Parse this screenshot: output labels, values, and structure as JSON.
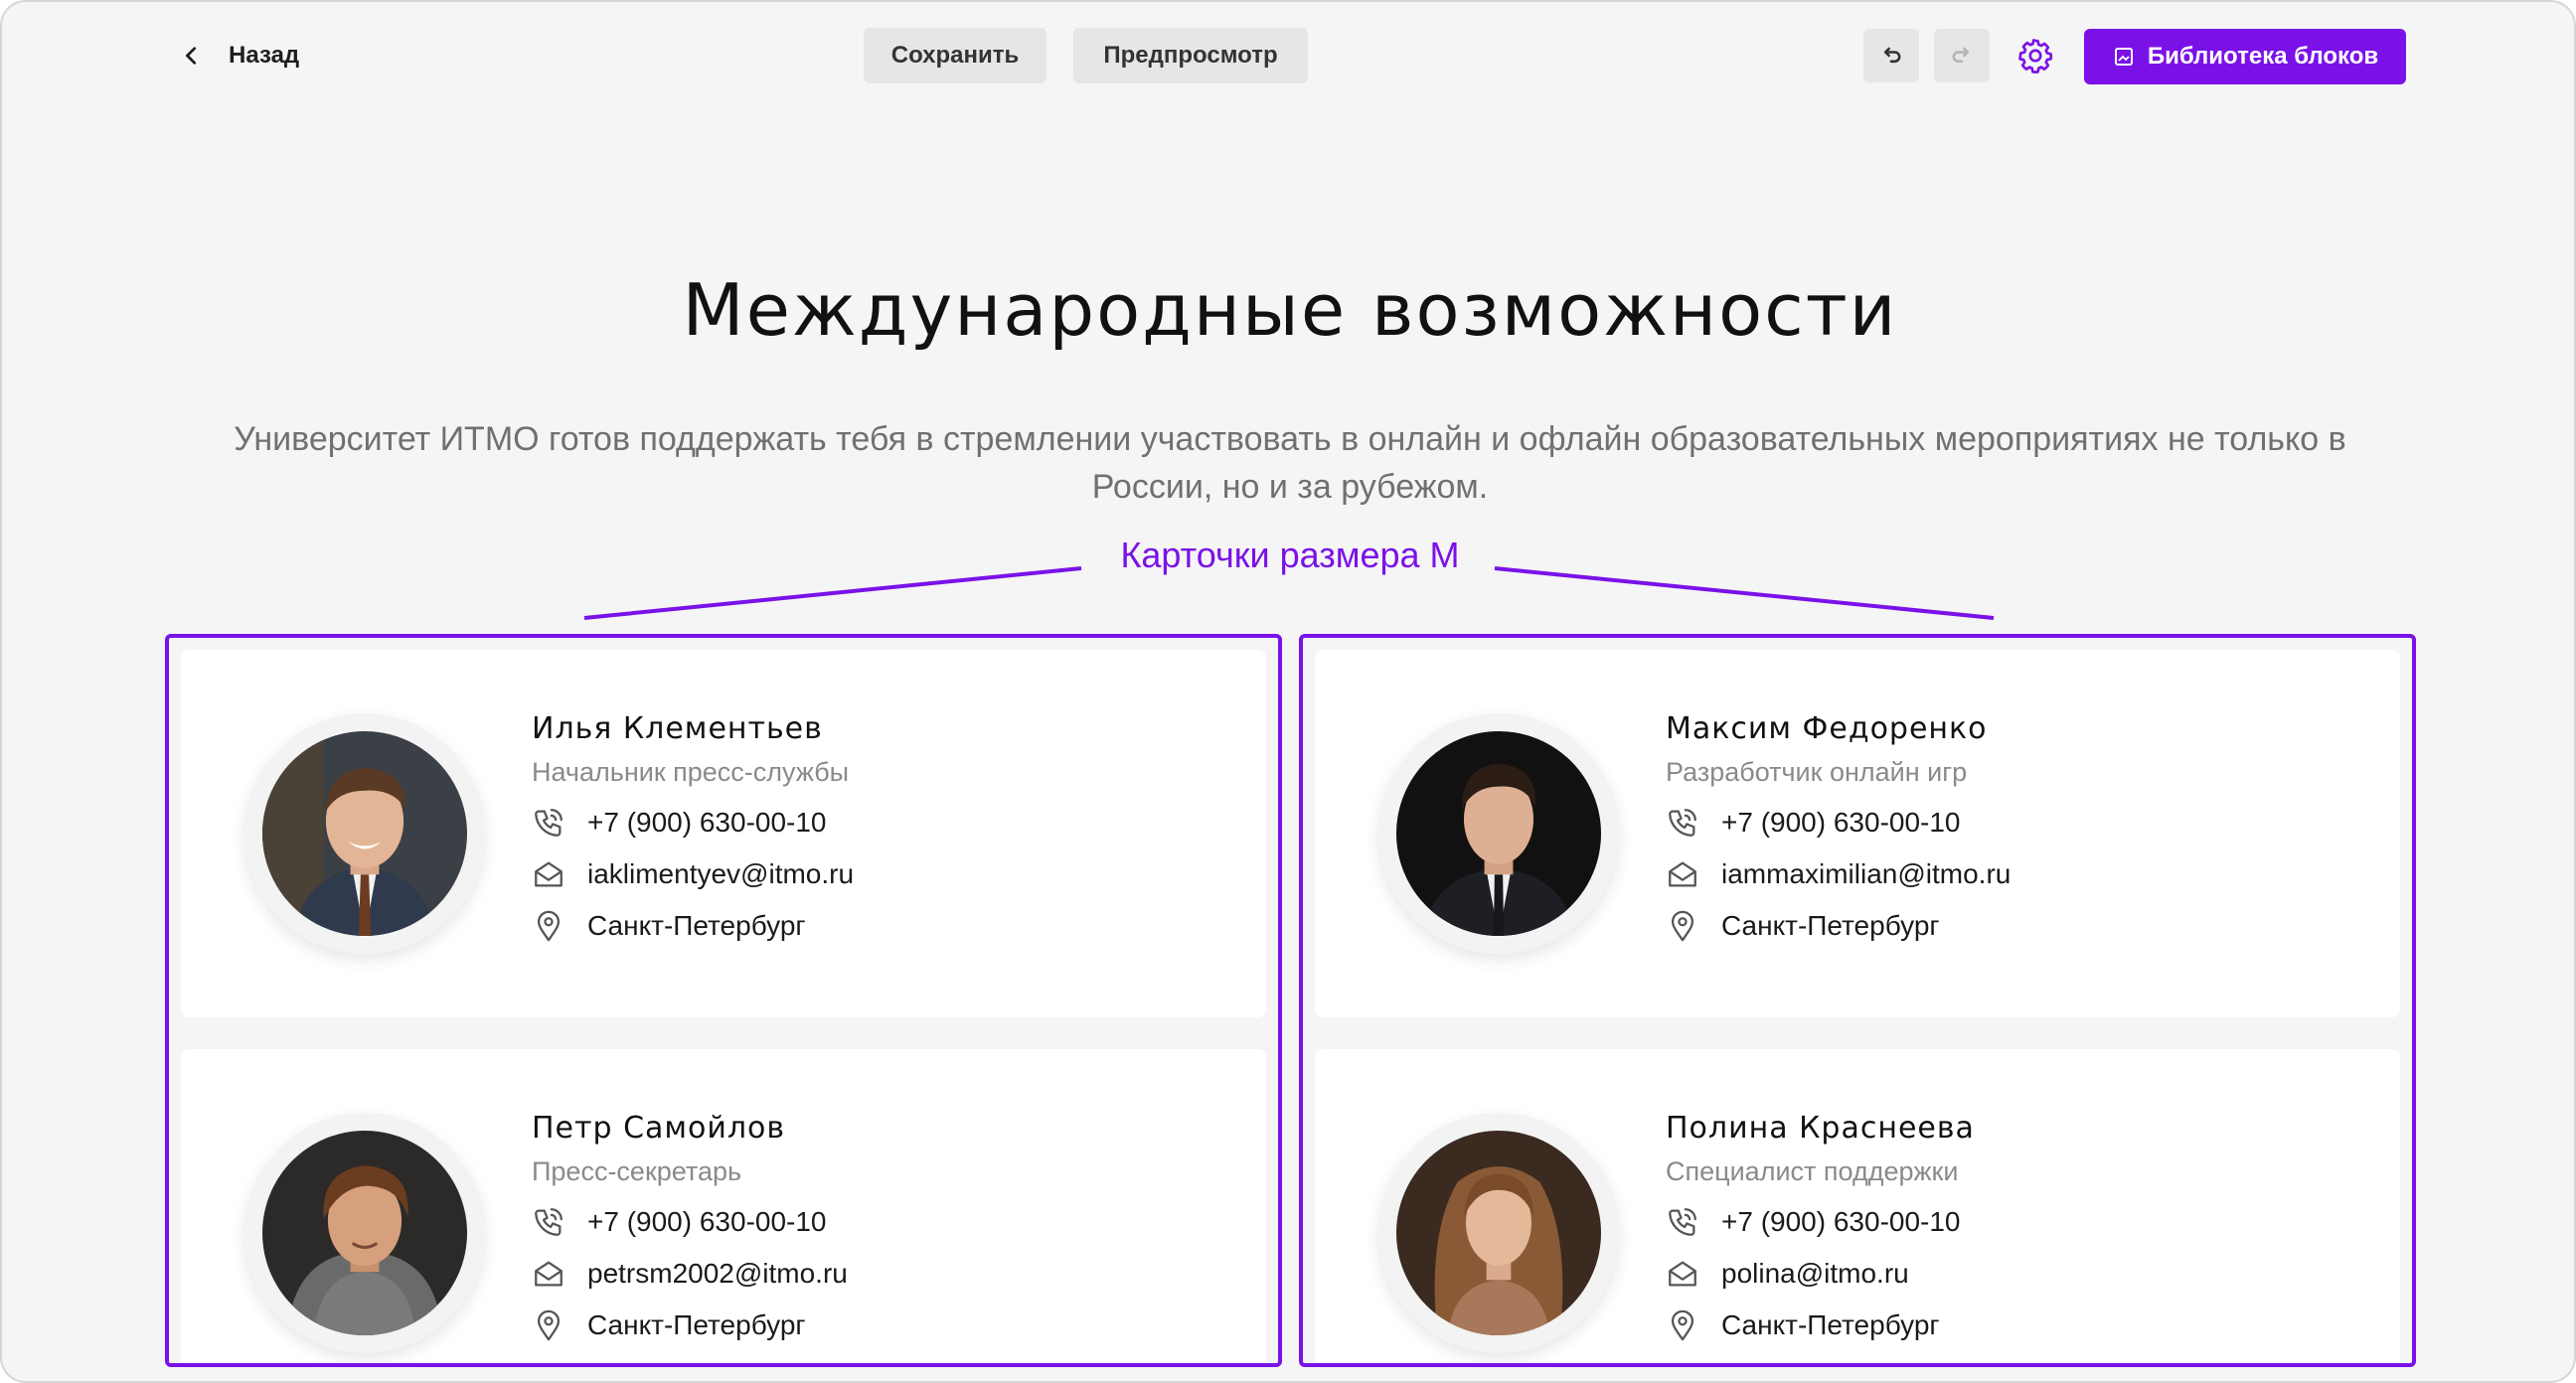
{
  "toolbar": {
    "back_label": "Назад",
    "save_label": "Сохранить",
    "preview_label": "Предпросмотр",
    "library_label": "Библиотека блоков"
  },
  "page": {
    "title": "Международные возможности",
    "subtitle": "Университет ИТМО готов поддержать тебя в стремлении участвовать в онлайн и офлайн образовательных мероприятиях не только в России, но и за рубежом.",
    "annotation": "Карточки размера М"
  },
  "colors": {
    "accent": "#7a12e8",
    "background": "#f5f5f5",
    "card": "#ffffff"
  },
  "groups": [
    {
      "cards": [
        {
          "name": "Илья Клементьев",
          "role": "Начальник пресс-службы",
          "phone": "+7 (900) 630-00-10",
          "email": "iaklimentyev@itmo.ru",
          "city": "Санкт-Петербург"
        },
        {
          "name": "Петр Самойлов",
          "role": "Пресс-секретарь",
          "phone": "+7 (900) 630-00-10",
          "email": "petrsm2002@itmo.ru",
          "city": "Санкт-Петербург"
        }
      ]
    },
    {
      "cards": [
        {
          "name": "Максим Федоренко",
          "role": "Разработчик онлайн игр",
          "phone": "+7 (900) 630-00-10",
          "email": "iammaximilian@itmo.ru",
          "city": "Санкт-Петербург"
        },
        {
          "name": "Полина Краснеева",
          "role": "Специалист поддержки",
          "phone": "+7 (900) 630-00-10",
          "email": "polina@itmo.ru",
          "city": "Санкт-Петербург"
        }
      ]
    }
  ]
}
